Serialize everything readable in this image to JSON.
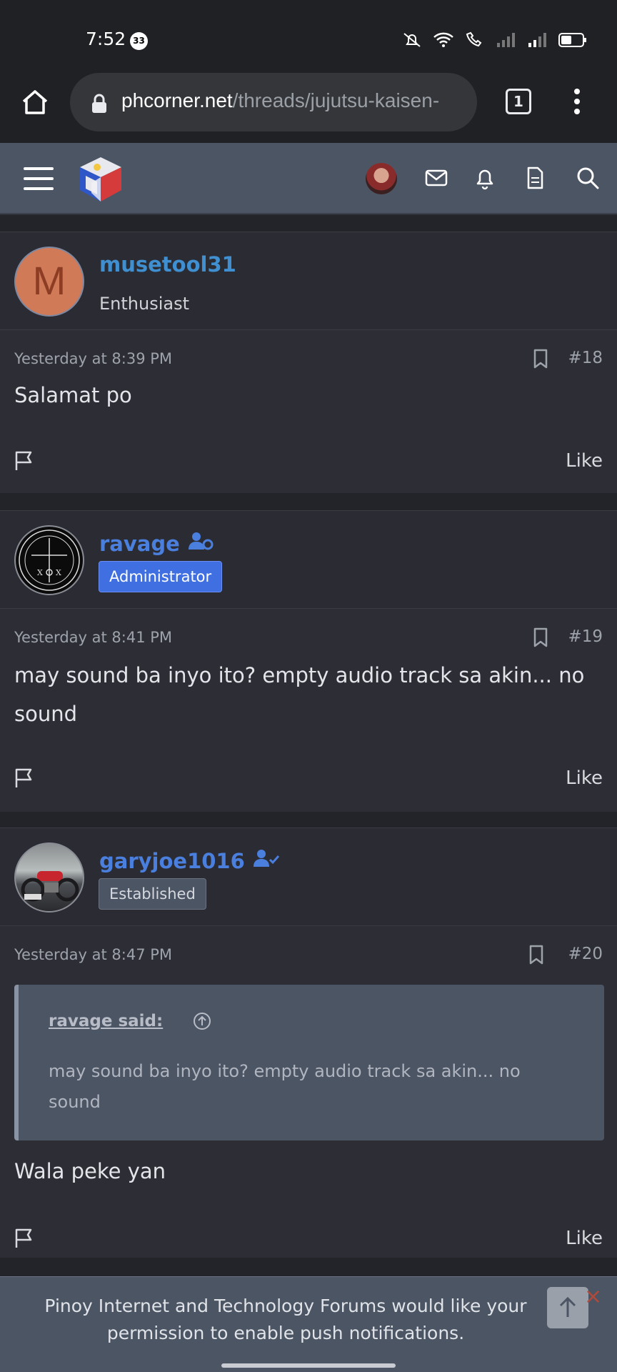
{
  "status_bar": {
    "time": "7:52",
    "notification_count": "33"
  },
  "browser": {
    "url_host": "phcorner.net",
    "url_path": "/threads/jujutsu-kaisen-",
    "tab_count": "1"
  },
  "posts": [
    {
      "username": "musetool31",
      "avatar_letter": "M",
      "user_title": "Enthusiast",
      "timestamp": "Yesterday at 8:39 PM",
      "post_number": "#18",
      "text": "Salamat po",
      "like_label": "Like"
    },
    {
      "username": "ravage",
      "user_badge": "Administrator",
      "timestamp": "Yesterday at 8:41 PM",
      "post_number": "#19",
      "text": "may sound ba inyo ito? empty audio track sa akin... no sound",
      "like_label": "Like"
    },
    {
      "username": "garyjoe1016",
      "user_badge": "Established",
      "timestamp": "Yesterday at 8:47 PM",
      "post_number": "#20",
      "quote_source": "ravage said:",
      "quote_text": "may sound ba inyo ito? empty audio track sa akin... no sound",
      "text": "Wala peke yan",
      "like_label": "Like"
    }
  ],
  "push_banner": {
    "message": "Pinoy Internet and Technology Forums would like your permission to enable push notifications."
  },
  "icons": {
    "home": "home-icon",
    "lock": "lock-icon",
    "menu": "more-vert-icon",
    "hamburger": "hamburger-icon",
    "mail": "mail-icon",
    "bell": "bell-icon",
    "doc": "document-icon",
    "search": "search-icon",
    "bookmark": "bookmark-icon",
    "flag": "flag-icon",
    "arrow_up": "arrow-up-icon"
  },
  "colors": {
    "header": "#4c5564",
    "background": "#2d2e35",
    "admin_badge": "#3f6fe0",
    "username_blue": "#3f8fd1"
  }
}
